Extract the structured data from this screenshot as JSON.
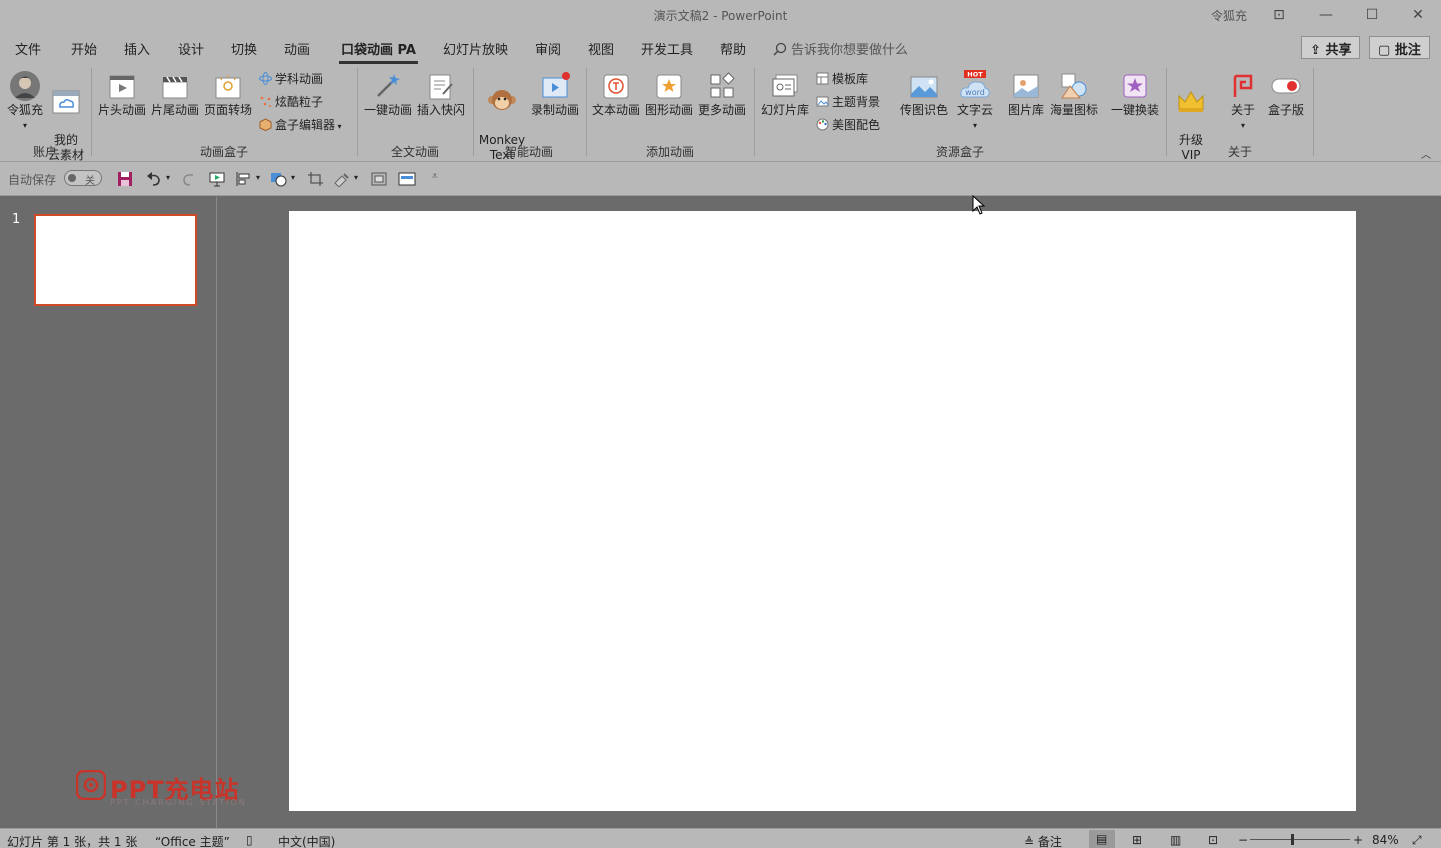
{
  "window": {
    "title": "演示文稿2  -  PowerPoint",
    "user": "令狐充",
    "controls": [
      "⊡",
      "—",
      "☐",
      "✕"
    ]
  },
  "tabs": [
    "文件",
    "开始",
    "插入",
    "设计",
    "切换",
    "动画",
    "口袋动画 PA",
    "幻灯片放映",
    "审阅",
    "视图",
    "开发工具",
    "帮助"
  ],
  "tellme": "告诉我你想要做什么",
  "share_label": "共享",
  "comment_label": "批注",
  "ribbon": {
    "account": {
      "label": "账户",
      "user": "令狐充",
      "cloud": "我的\n云素材"
    },
    "anim_box": {
      "label": "动画盒子",
      "intro": "片头动画",
      "outro": "片尾动画",
      "page": "页面转场",
      "science": "学科动画",
      "particles": "炫酷粒子",
      "editor": "盒子编辑器"
    },
    "full_text": {
      "label": "全文动画",
      "one_click": "一键动画",
      "flash": "插入快闪"
    },
    "smart": {
      "label": "智能动画",
      "monkey": "Monkey\nText",
      "record": "录制动画"
    },
    "add_anim": {
      "label": "添加动画",
      "text": "文本动画",
      "shape": "图形动画",
      "more": "更多动画"
    },
    "resource": {
      "label": "资源盒子",
      "slides": "幻灯片库",
      "templates": "模板库",
      "theme_bg": "主题背景",
      "palette": "美图配色",
      "pic_color": "传图识色",
      "word_cloud": "文字云",
      "hot": "HOT",
      "word": "word",
      "pictures": "图片库",
      "icons": "海量图标",
      "replace": "一键换装"
    },
    "about": {
      "label": "关于",
      "vip": "升级\nVIP",
      "about": "关于",
      "box_edition": "盒子版"
    }
  },
  "qat": {
    "autosave": "自动保存",
    "toggle_state": "关"
  },
  "thumbs": {
    "slide_number": "1"
  },
  "watermark": {
    "text": "PPT充电站",
    "sub": "PPT CHARGING STATION"
  },
  "status": {
    "slide_info": "幻灯片 第 1 张，共 1 张",
    "theme": "“Office 主题”",
    "language": "中文(中国)",
    "notes": "备注",
    "zoom": "84%"
  }
}
